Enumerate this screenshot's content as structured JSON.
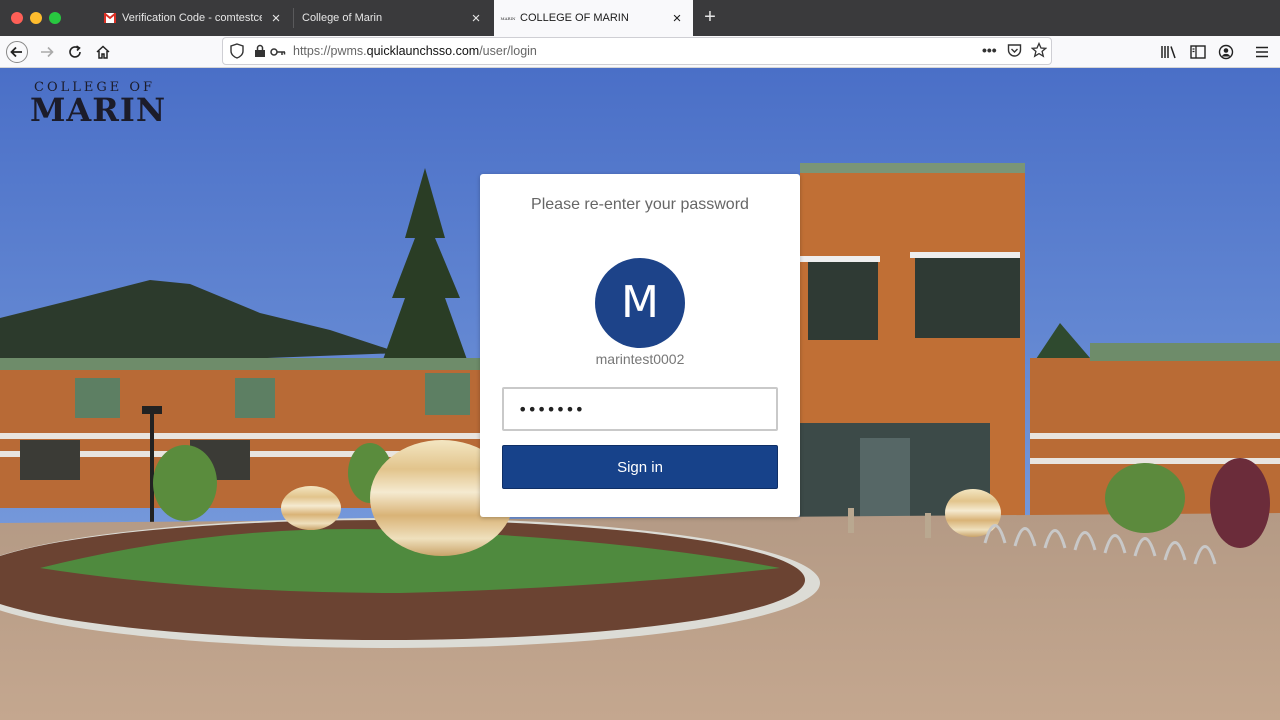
{
  "browser": {
    "tabs": [
      {
        "title": "Verification Code - comtestcen",
        "icon": "gmail-icon",
        "active": false
      },
      {
        "title": "College of Marin",
        "icon": "",
        "active": false
      },
      {
        "title": "COLLEGE OF MARIN",
        "icon": "college-marin-favicon",
        "favicon_text": "MARIN",
        "active": true
      }
    ],
    "url": {
      "prefix": "https://pwms.",
      "host": "quicklaunchsso.com",
      "path": "/user/login"
    }
  },
  "page": {
    "logo": {
      "top": "COLLEGE OF",
      "main": "MARIN"
    },
    "login": {
      "heading": "Please re-enter your password",
      "avatar_letter": "M",
      "username": "marintest0002",
      "password_value": "•••••••",
      "signin_label": "Sign in"
    }
  },
  "colors": {
    "accent": "#17428a",
    "avatar": "#1d4389",
    "chrome_dark": "#3a3a3c"
  }
}
